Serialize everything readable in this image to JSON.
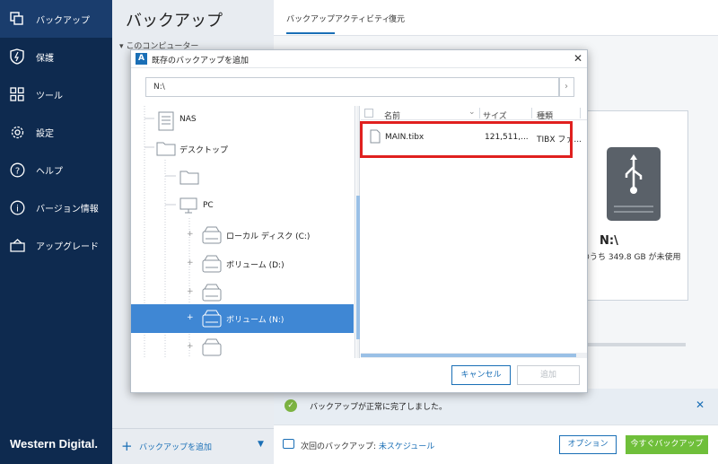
{
  "nav": {
    "items": [
      {
        "label": "バックアップ",
        "icon": "copy-icon"
      },
      {
        "label": "保護",
        "icon": "shield-icon"
      },
      {
        "label": "ツール",
        "icon": "grid-icon"
      },
      {
        "label": "設定",
        "icon": "gear-icon"
      },
      {
        "label": "ヘルプ",
        "icon": "help-icon"
      },
      {
        "label": "バージョン情報",
        "icon": "info-icon"
      },
      {
        "label": "アップグレード",
        "icon": "cart-icon"
      }
    ],
    "brand": "Western Digital."
  },
  "mid": {
    "title": "バックアップ",
    "computer_label": "このコンピューター",
    "add_backup": "バックアップを追加"
  },
  "main": {
    "tabs": [
      "バックアップ",
      "アクティビティ",
      "復元"
    ],
    "drive_name": "N:\\",
    "drive_free": "のうち 349.8 GB が未使用",
    "status": "バックアップが正常に完了しました。",
    "next_backup_label": "次回のバックアップ: ",
    "next_backup_value": "未スケジュール",
    "options_button": "オプション",
    "backup_now_button": "今すぐバックアップ"
  },
  "dialog": {
    "title": "既存のバックアップを追加",
    "path": "N:\\",
    "tree": [
      {
        "label": "NAS",
        "type": "nas"
      },
      {
        "label": "デスクトップ",
        "type": "folder"
      },
      {
        "label": "",
        "type": "folder"
      },
      {
        "label": "PC",
        "type": "pc"
      },
      {
        "label": "ローカル ディスク (C:)",
        "type": "drive"
      },
      {
        "label": "ボリューム (D:)",
        "type": "drive"
      },
      {
        "label": "",
        "type": "drive"
      },
      {
        "label": "ボリューム (N:)",
        "type": "drive",
        "selected": true
      },
      {
        "label": "",
        "type": "drive"
      }
    ],
    "columns": [
      "名前",
      "サイズ",
      "種類"
    ],
    "files": [
      {
        "name": "MAIN.tibx",
        "size": "121,511,...",
        "type": "TIBX ファ..."
      }
    ],
    "cancel_button": "キャンセル",
    "add_button": "追加"
  },
  "colors": {
    "nav_bg": "#0e2a4f",
    "accent": "#1a6fb6",
    "selection": "#3f87d4",
    "highlight_box": "#e0201f",
    "success": "#7cb342",
    "backup_now": "#6fbf3a"
  }
}
